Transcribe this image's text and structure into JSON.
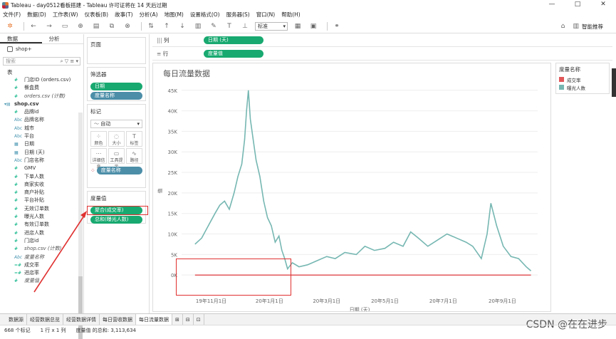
{
  "window": {
    "title": "Tableau - day0512看板搭建 - Tableau 许可证将在 14 天后过期",
    "controls": [
      "—",
      "□",
      "✕"
    ]
  },
  "menu": [
    "文件(F)",
    "数据(D)",
    "工作表(W)",
    "仪表板(B)",
    "故事(T)",
    "分析(A)",
    "地图(M)",
    "设置格式(O)",
    "服务器(S)",
    "窗口(N)",
    "帮助(H)"
  ],
  "toolbar": {
    "fit_select": "标准",
    "smart_recommend": "智能推荐"
  },
  "data_pane": {
    "tabs": [
      "数据",
      "分析"
    ],
    "source": "shop+",
    "search_placeholder": "搜索",
    "tables_header": "表",
    "fields": [
      {
        "type": "#",
        "name": "门店ID (orders.csv)",
        "kind": "num"
      },
      {
        "type": "#",
        "name": "餐盒费",
        "kind": "num"
      },
      {
        "type": "#",
        "name": "orders.csv (计数)",
        "kind": "num",
        "italic": true
      },
      {
        "type": "▾▤",
        "name": "shop.csv",
        "kind": "table",
        "bold": true
      },
      {
        "type": "#",
        "name": "品牌id",
        "kind": "num"
      },
      {
        "type": "Abc",
        "name": "品牌名称",
        "kind": "str"
      },
      {
        "type": "Abc",
        "name": "城市",
        "kind": "str"
      },
      {
        "type": "Abc",
        "name": "平台",
        "kind": "str"
      },
      {
        "type": "▦",
        "name": "日期",
        "kind": "str"
      },
      {
        "type": "▦",
        "name": "日期 (天)",
        "kind": "str"
      },
      {
        "type": "Abc",
        "name": "门店名称",
        "kind": "str"
      },
      {
        "type": "#",
        "name": "GMV",
        "kind": "num"
      },
      {
        "type": "#",
        "name": "下单人数",
        "kind": "num"
      },
      {
        "type": "#",
        "name": "商家实收",
        "kind": "num"
      },
      {
        "type": "#",
        "name": "商户补贴",
        "kind": "num"
      },
      {
        "type": "#",
        "name": "平台补贴",
        "kind": "num"
      },
      {
        "type": "#",
        "name": "无效订单数",
        "kind": "num"
      },
      {
        "type": "#",
        "name": "曝光人数",
        "kind": "num"
      },
      {
        "type": "#",
        "name": "有效订单数",
        "kind": "num"
      },
      {
        "type": "#",
        "name": "进店人数",
        "kind": "num"
      },
      {
        "type": "#",
        "name": "门店id",
        "kind": "num"
      },
      {
        "type": "#",
        "name": "shop.csv (计数)",
        "kind": "num",
        "italic": true
      },
      {
        "type": "Abc",
        "name": "度量名称",
        "kind": "str",
        "italic": true
      },
      {
        "type": "=#",
        "name": "成交率",
        "kind": "num"
      },
      {
        "type": "=#",
        "name": "进店率",
        "kind": "num"
      },
      {
        "type": "#",
        "name": "度量值",
        "kind": "num",
        "italic": true
      }
    ]
  },
  "cards": {
    "pages": "页面",
    "filters": "筛选器",
    "filter_pills": [
      "日期",
      "度量名称"
    ],
    "marks": "标记",
    "marks_type": "自动",
    "marks_buttons": [
      {
        "glyph": "⁘",
        "label": "颜色"
      },
      {
        "glyph": "◌",
        "label": "大小"
      },
      {
        "glyph": "T",
        "label": "标签"
      },
      {
        "glyph": "⋯",
        "label": "详细信息"
      },
      {
        "glyph": "▭",
        "label": "工具提示"
      },
      {
        "glyph": "∿",
        "label": "路径"
      }
    ],
    "marks_color_pill": "度量名称",
    "measure_values": "度量值",
    "measure_pills": [
      "聚合(成交率)",
      "总和(曝光人数)"
    ]
  },
  "shelves": {
    "columns_label": "列",
    "columns_pill": "日期 (天)",
    "rows_label": "行",
    "rows_pill": "度量值"
  },
  "worksheet": {
    "title": "每日流量数据"
  },
  "legend": {
    "title": "度量名称",
    "items": [
      {
        "label": "成交率",
        "color": "#e15759"
      },
      {
        "label": "曝光人数",
        "color": "#76b7b2"
      }
    ]
  },
  "chart_data": {
    "type": "line",
    "title": "每日流量数据",
    "xlabel": "日期 (天)",
    "ylabel": "值",
    "x_ticks": [
      "19年11月1日",
      "20年1月1日",
      "20年3月1日",
      "20年5月1日",
      "20年7月1日",
      "20年9月1日"
    ],
    "y_ticks": [
      "0K",
      "5K",
      "10K",
      "15K",
      "20K",
      "25K",
      "30K",
      "35K",
      "40K",
      "45K"
    ],
    "ylim": [
      -5000,
      46000
    ],
    "grid": true,
    "series": [
      {
        "name": "曝光人数",
        "color": "#76b7b2",
        "x": [
          "2019-10-15",
          "2019-10-22",
          "2019-10-29",
          "2019-11-05",
          "2019-11-10",
          "2019-11-15",
          "2019-11-20",
          "2019-11-25",
          "2019-11-29",
          "2019-12-03",
          "2019-12-06",
          "2019-12-08",
          "2019-12-10",
          "2019-12-12",
          "2019-12-15",
          "2019-12-18",
          "2019-12-22",
          "2019-12-26",
          "2019-12-30",
          "2020-01-03",
          "2020-01-07",
          "2020-01-11",
          "2020-01-14",
          "2020-01-17",
          "2020-01-20",
          "2020-01-25",
          "2020-02-01",
          "2020-02-10",
          "2020-02-20",
          "2020-03-01",
          "2020-03-10",
          "2020-03-20",
          "2020-04-01",
          "2020-04-10",
          "2020-04-20",
          "2020-05-01",
          "2020-05-10",
          "2020-05-20",
          "2020-05-28",
          "2020-06-05",
          "2020-06-15",
          "2020-06-25",
          "2020-07-05",
          "2020-07-15",
          "2020-07-25",
          "2020-08-01",
          "2020-08-10",
          "2020-08-16",
          "2020-08-20",
          "2020-08-26",
          "2020-09-02",
          "2020-09-10",
          "2020-09-18",
          "2020-09-26",
          "2020-10-01"
        ],
        "values": [
          7500,
          9000,
          12000,
          15000,
          17000,
          18000,
          16000,
          20000,
          24000,
          27000,
          33000,
          40000,
          45000,
          38000,
          33000,
          28000,
          24000,
          18000,
          14000,
          12000,
          8000,
          9500,
          6000,
          4000,
          1500,
          3000,
          2000,
          2500,
          3500,
          4500,
          4000,
          5500,
          5000,
          7000,
          6000,
          6500,
          8000,
          7000,
          10500,
          9000,
          7000,
          8500,
          10000,
          9000,
          8000,
          7000,
          4000,
          10000,
          17500,
          12000,
          7000,
          4500,
          4000,
          2000,
          1000
        ]
      },
      {
        "name": "成交率",
        "color": "#e15759",
        "x": [
          "2019-10-15",
          "2020-10-01"
        ],
        "values": [
          0,
          0
        ]
      }
    ]
  },
  "tabs": [
    "数据源",
    "经营数据总览",
    "经营数据详情",
    "每日营收数据",
    "每日流量数据"
  ],
  "active_tab": "每日流量数据",
  "status": {
    "marks": "668 个标记",
    "rows_cols": "1 行 x 1 列",
    "sum": "度量值 的总和: 3,113,634"
  },
  "watermark": "CSDN @在在进步"
}
